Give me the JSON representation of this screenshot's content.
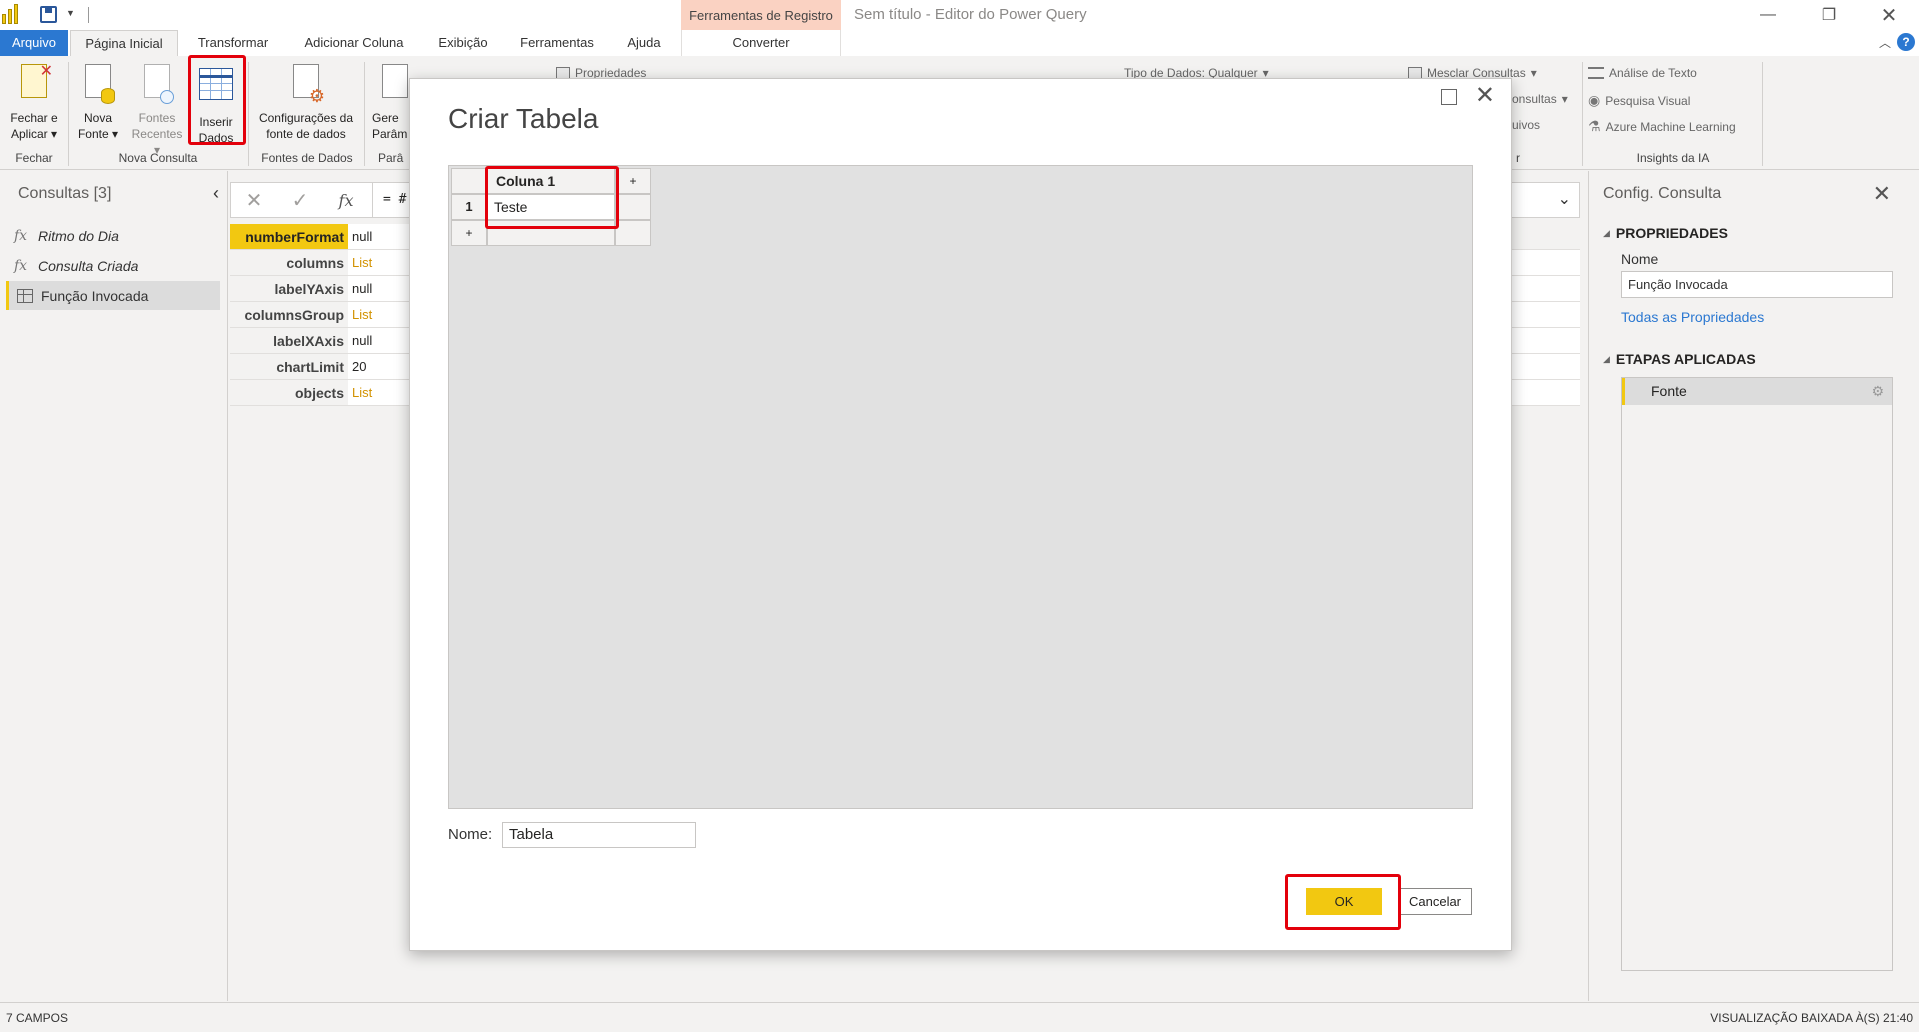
{
  "window": {
    "title": "Sem título - Editor do Power Query",
    "context_tab_group": "Ferramentas de Registro"
  },
  "tabs": [
    {
      "label": "Arquivo"
    },
    {
      "label": "Página Inicial"
    },
    {
      "label": "Transformar"
    },
    {
      "label": "Adicionar Coluna"
    },
    {
      "label": "Exibição"
    },
    {
      "label": "Ferramentas"
    },
    {
      "label": "Ajuda"
    },
    {
      "label": "Converter"
    }
  ],
  "ribbon": {
    "fechar_aplicar": {
      "line1": "Fechar e",
      "line2": "Aplicar"
    },
    "nova_fonte": {
      "line1": "Nova",
      "line2": "Fonte"
    },
    "fontes_recentes": {
      "line1": "Fontes",
      "line2": "Recentes"
    },
    "inserir_dados": {
      "line1": "Inserir",
      "line2": "Dados"
    },
    "config_fonte": {
      "line1": "Configurações da",
      "line2": "fonte de dados"
    },
    "gerenciar_param": {
      "line1": "Gere",
      "line2": "Parâm"
    },
    "propriedades": "Propriedades",
    "tipo_dados": "Tipo de Dados: Qualquer",
    "mesclar": "Mesclar Consultas",
    "consultas_frag": "onsultas",
    "arquivos_frag": "uivos",
    "analise_texto": "Análise de Texto",
    "pesquisa_visual": "Pesquisa Visual",
    "azure_ml": "Azure Machine Learning",
    "groups": {
      "fechar": "Fechar",
      "nova_consulta": "Nova Consulta",
      "fontes_dados": "Fontes de Dados",
      "param": "Parâ",
      "combinar_frag": "r",
      "insights": "Insights da IA"
    }
  },
  "queries": {
    "header": "Consultas [3]",
    "items": [
      {
        "label": "Ritmo do Dia",
        "icon": "fx-icon"
      },
      {
        "label": "Consulta Criada",
        "icon": "fx-icon"
      },
      {
        "label": "Função Invocada",
        "icon": "table-icon"
      }
    ]
  },
  "formula": {
    "text": "= #"
  },
  "record": [
    {
      "key": "numberFormat",
      "value": "null"
    },
    {
      "key": "columns",
      "value": "List"
    },
    {
      "key": "labelYAxis",
      "value": "null"
    },
    {
      "key": "columnsGroup",
      "value": "List"
    },
    {
      "key": "labelXAxis",
      "value": "null"
    },
    {
      "key": "chartLimit",
      "value": "20"
    },
    {
      "key": "objects",
      "value": "List"
    }
  ],
  "settings": {
    "title": "Config. Consulta",
    "properties_header": "PROPRIEDADES",
    "name_label": "Nome",
    "name_value": "Função Invocada",
    "all_properties": "Todas as Propriedades",
    "steps_header": "ETAPAS APLICADAS",
    "steps": [
      {
        "label": "Fonte"
      }
    ]
  },
  "status": {
    "left": "7 CAMPOS",
    "right": "VISUALIZAÇÃO BAIXADA À(S) 21:40"
  },
  "dialog": {
    "title": "Criar Tabela",
    "column_header": "Coluna 1",
    "add_symbol": "+",
    "row_number": "1",
    "cell_value": "Teste",
    "name_label": "Nome:",
    "name_value": "Tabela",
    "ok_label": "OK",
    "cancel_label": "Cancelar"
  },
  "colors": {
    "accent_yellow": "#f2c811",
    "file_tab_blue": "#2b78d1",
    "highlight_red": "#e3000b",
    "context_tab": "#fad2c2"
  }
}
